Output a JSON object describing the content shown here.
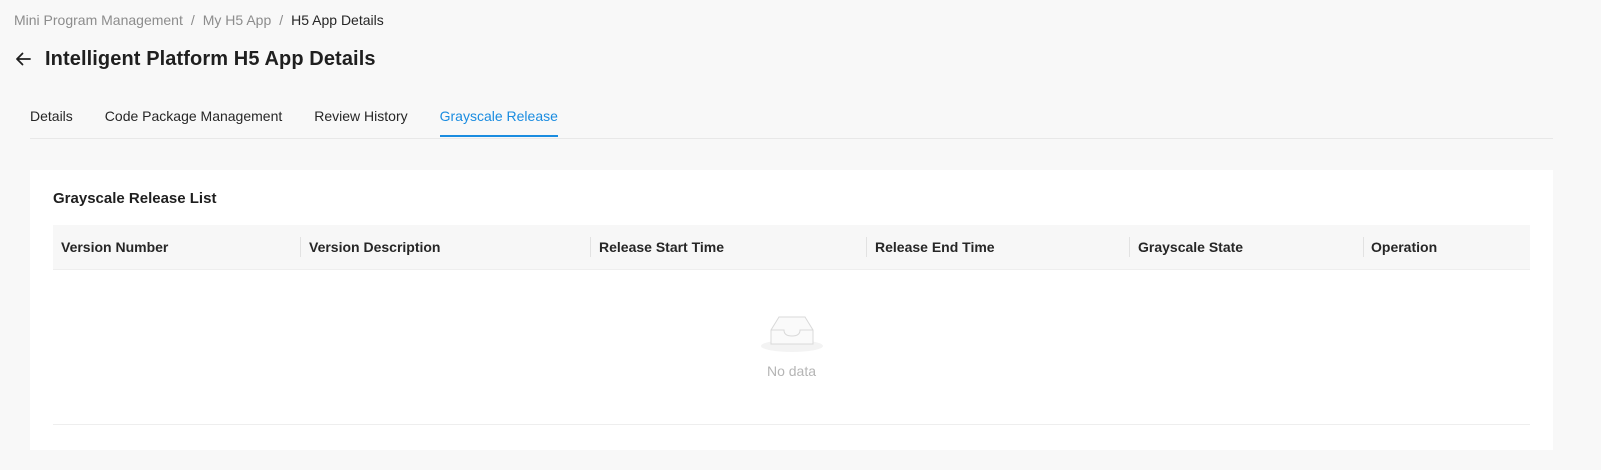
{
  "breadcrumb": {
    "items": [
      "Mini Program Management",
      "My H5 App"
    ],
    "separator": "/",
    "current": "H5 App Details"
  },
  "header": {
    "back_icon": "arrow-left-icon",
    "title": "Intelligent Platform H5 App Details"
  },
  "tabs": [
    {
      "label": "Details",
      "active": false
    },
    {
      "label": "Code Package Management",
      "active": false
    },
    {
      "label": "Review History",
      "active": false
    },
    {
      "label": "Grayscale Release",
      "active": true
    }
  ],
  "card": {
    "title": "Grayscale Release List",
    "table": {
      "columns": [
        "Version Number",
        "Version Description",
        "Release Start Time",
        "Release End Time",
        "Grayscale State",
        "Operation"
      ],
      "rows": []
    },
    "empty": {
      "icon": "empty-inbox-icon",
      "text": "No data"
    }
  },
  "colors": {
    "accent": "#1a8ce0",
    "page_background": "#f8f8f8",
    "card_background": "#ffffff",
    "header_background": "#f7f7f7"
  }
}
